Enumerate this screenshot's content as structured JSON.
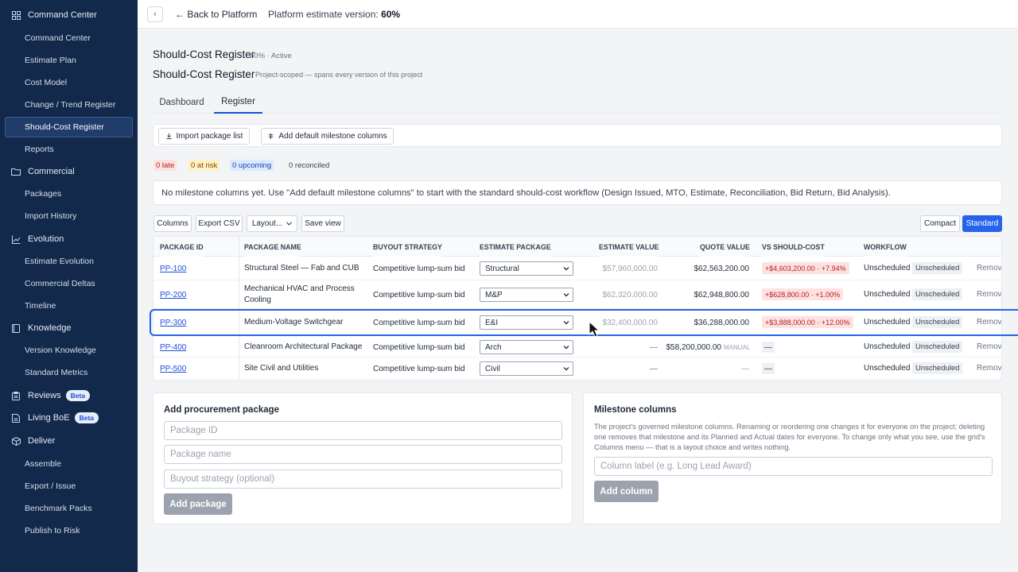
{
  "sidebar": {
    "items": [
      {
        "label": "Command Center",
        "type": "group",
        "icon": "grid-icon"
      },
      {
        "label": "Command Center",
        "type": "sub"
      },
      {
        "label": "Estimate Plan",
        "type": "sub"
      },
      {
        "label": "Cost Model",
        "type": "sub"
      },
      {
        "label": "Change / Trend Register",
        "type": "sub"
      },
      {
        "label": "Should-Cost Register",
        "type": "sub",
        "active": true
      },
      {
        "label": "Reports",
        "type": "sub"
      },
      {
        "label": "Commercial",
        "type": "group",
        "icon": "folder-icon"
      },
      {
        "label": "Packages",
        "type": "sub"
      },
      {
        "label": "Import History",
        "type": "sub"
      },
      {
        "label": "Evolution",
        "type": "group",
        "icon": "chart-line-icon"
      },
      {
        "label": "Estimate Evolution",
        "type": "sub"
      },
      {
        "label": "Commercial Deltas",
        "type": "sub"
      },
      {
        "label": "Timeline",
        "type": "sub"
      },
      {
        "label": "Knowledge",
        "type": "group",
        "icon": "book-icon"
      },
      {
        "label": "Version Knowledge",
        "type": "sub"
      },
      {
        "label": "Standard Metrics",
        "type": "sub"
      },
      {
        "label": "Reviews",
        "type": "group",
        "icon": "clipboard-icon",
        "badge": "Beta"
      },
      {
        "label": "Living BoE",
        "type": "group",
        "icon": "doc-icon",
        "badge": "Beta"
      },
      {
        "label": "Deliver",
        "type": "group",
        "icon": "cube-icon"
      },
      {
        "label": "Assemble",
        "type": "sub"
      },
      {
        "label": "Export / Issue",
        "type": "sub"
      },
      {
        "label": "Benchmark Packs",
        "type": "sub"
      },
      {
        "label": "Publish to Risk",
        "type": "sub"
      }
    ]
  },
  "topbar": {
    "collapse": "‹",
    "back": "← Back to Platform",
    "version_label": "Platform estimate version:",
    "version_value": "60%"
  },
  "header": {
    "title": "Should-Cost Register",
    "title_meta": "60% · Active",
    "subtitle": "Should-Cost Register",
    "subtitle_meta": "Project-scoped — spans every version of this project"
  },
  "tabs": [
    "Dashboard",
    "Register"
  ],
  "toolbar": {
    "import": "Import package list",
    "add_milestones": "Add default milestone columns"
  },
  "status": {
    "late": "0 late",
    "at_risk": "0 at risk",
    "upcoming": "0 upcoming",
    "reconciled": "0 reconciled"
  },
  "notice": "No milestone columns yet. Use \"Add default milestone columns\" to start with the standard should-cost workflow (Design Issued, MTO, Estimate, Reconciliation, Bid Return, Bid Analysis).",
  "grid_toolbar": {
    "columns": "Columns",
    "export": "Export CSV",
    "layout": "Layout...",
    "save_view": "Save view",
    "compact": "Compact",
    "standard": "Standard"
  },
  "table": {
    "headers": [
      "PACKAGE ID",
      "PACKAGE NAME",
      "BUYOUT STRATEGY",
      "ESTIMATE PACKAGE",
      "ESTIMATE VALUE",
      "QUOTE VALUE",
      "VS SHOULD-COST",
      "WORKFLOW"
    ],
    "rows": [
      {
        "id": "PP-100",
        "name": "Structural Steel — Fab and CUB",
        "strategy": "Competitive lump-sum bid",
        "package": "Structural",
        "estimate": "$57,960,000.00",
        "quote": "$62,563,200.00",
        "quote_tag": "",
        "vs": "+$4,603,200.00 · +7.94%",
        "wf": "Unscheduled",
        "wf_badge": "Unscheduled",
        "remove": "Remove"
      },
      {
        "id": "PP-200",
        "name": "Mechanical HVAC and Process Cooling",
        "strategy": "Competitive lump-sum bid",
        "package": "M&P",
        "estimate": "$62,320,000.00",
        "quote": "$62,948,800.00",
        "quote_tag": "",
        "vs": "+$628,800.00 · +1.00%",
        "wf": "Unscheduled",
        "wf_badge": "Unscheduled",
        "remove": "Remove"
      },
      {
        "id": "PP-300",
        "name": "Medium-Voltage Switchgear",
        "strategy": "Competitive lump-sum bid",
        "package": "E&I",
        "estimate": "$32,400,000.00",
        "quote": "$36,288,000.00",
        "quote_tag": "",
        "vs": "+$3,888,000.00 · +12.00%",
        "wf": "Unscheduled",
        "wf_badge": "Unscheduled",
        "remove": "Remove"
      },
      {
        "id": "PP-400",
        "name": "Cleanroom Architectural Package",
        "strategy": "Competitive lump-sum bid",
        "package": "Arch",
        "estimate": "—",
        "quote": "$58,200,000.00",
        "quote_tag": "MANUAL",
        "vs": "—",
        "wf": "Unscheduled",
        "wf_badge": "Unscheduled",
        "remove": "Remove"
      },
      {
        "id": "PP-500",
        "name": "Site Civil and Utilities",
        "strategy": "Competitive lump-sum bid",
        "package": "Civil",
        "estimate": "—",
        "quote": "—",
        "quote_tag": "",
        "vs": "—",
        "wf": "Unscheduled",
        "wf_badge": "Unscheduled",
        "remove": "Remove"
      }
    ]
  },
  "add_package": {
    "title": "Add procurement package",
    "id_placeholder": "Package ID",
    "name_placeholder": "Package name",
    "strategy_placeholder": "Buyout strategy (optional)",
    "button": "Add package"
  },
  "milestones": {
    "title": "Milestone columns",
    "description": "The project's governed milestone columns. Renaming or reordering one changes it for everyone on the project; deleting one removes that milestone and its Planned and Actual dates for everyone. To change only what you see, use the grid's Columns menu — that is a layout choice and writes nothing.",
    "placeholder": "Column label (e.g. Long Lead Award)",
    "button": "Add column"
  },
  "colors": {
    "sidebar_bg": "#13294b",
    "accent": "#1d4ed8",
    "danger_bg": "#fde2e2",
    "danger_text": "#b91c1c"
  }
}
